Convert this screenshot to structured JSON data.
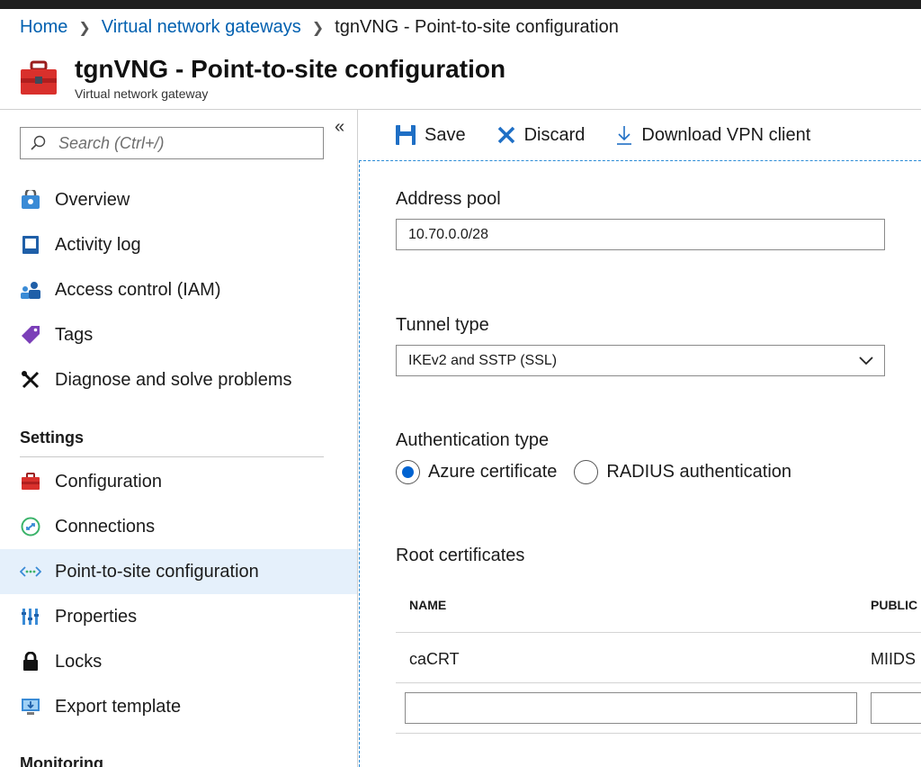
{
  "breadcrumb": {
    "home": "Home",
    "parent": "Virtual network gateways",
    "current": "tgnVNG - Point-to-site configuration"
  },
  "header": {
    "title": "tgnVNG - Point-to-site configuration",
    "subtitle": "Virtual network gateway"
  },
  "sidebar": {
    "search_placeholder": "Search (Ctrl+/)",
    "collapse_glyph": "«",
    "items": [
      {
        "label": "Overview",
        "icon": "overview-icon"
      },
      {
        "label": "Activity log",
        "icon": "activity-log-icon"
      },
      {
        "label": "Access control (IAM)",
        "icon": "access-control-icon"
      },
      {
        "label": "Tags",
        "icon": "tag-icon"
      },
      {
        "label": "Diagnose and solve problems",
        "icon": "wrench-icon"
      }
    ],
    "settings_title": "Settings",
    "settings_items": [
      {
        "label": "Configuration",
        "icon": "toolbox-icon"
      },
      {
        "label": "Connections",
        "icon": "connections-icon"
      },
      {
        "label": "Point-to-site configuration",
        "icon": "point-to-site-icon",
        "active": true
      },
      {
        "label": "Properties",
        "icon": "properties-icon"
      },
      {
        "label": "Locks",
        "icon": "lock-icon"
      },
      {
        "label": "Export template",
        "icon": "export-icon"
      }
    ],
    "monitoring_title": "Monitoring"
  },
  "toolbar": {
    "save": "Save",
    "discard": "Discard",
    "download": "Download VPN client"
  },
  "form": {
    "address_pool_label": "Address pool",
    "address_pool_value": "10.70.0.0/28",
    "tunnel_type_label": "Tunnel type",
    "tunnel_type_value": "IKEv2 and SSTP (SSL)",
    "auth_type_label": "Authentication type",
    "auth_options": [
      {
        "label": "Azure certificate",
        "selected": true
      },
      {
        "label": "RADIUS authentication",
        "selected": false
      }
    ],
    "root_cert_label": "Root certificates",
    "table_headers": [
      "NAME",
      "PUBLIC"
    ],
    "rows": [
      {
        "name": "caCRT",
        "public": "MIIDS"
      }
    ]
  },
  "colors": {
    "link": "#0060b0",
    "active_bg": "#e5f0fb",
    "accent": "#0063d1"
  }
}
